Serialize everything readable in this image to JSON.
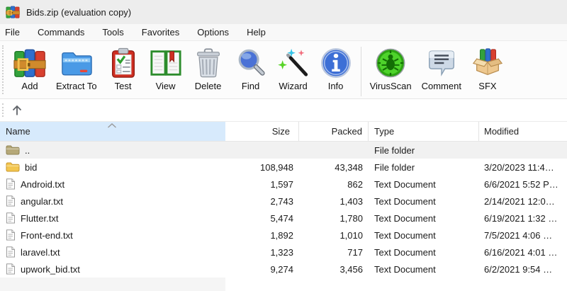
{
  "window": {
    "title": "Bids.zip (evaluation copy)",
    "app_icon": "winrar-archive-icon"
  },
  "menu_bar": {
    "items": [
      "File",
      "Commands",
      "Tools",
      "Favorites",
      "Options",
      "Help"
    ]
  },
  "toolbar": {
    "buttons": [
      {
        "label": "Add",
        "icon": "add-archive-icon"
      },
      {
        "label": "Extract To",
        "icon": "extract-to-folder-icon"
      },
      {
        "label": "Test",
        "icon": "test-clipboard-icon"
      },
      {
        "label": "View",
        "icon": "view-book-icon"
      },
      {
        "label": "Delete",
        "icon": "delete-trash-icon"
      },
      {
        "label": "Find",
        "icon": "find-magnifier-icon"
      },
      {
        "label": "Wizard",
        "icon": "wizard-wand-icon"
      },
      {
        "label": "Info",
        "icon": "info-circle-icon"
      },
      {
        "label": "VirusScan",
        "icon": "virus-scan-bug-icon"
      },
      {
        "label": "Comment",
        "icon": "comment-bubble-icon"
      },
      {
        "label": "SFX",
        "icon": "sfx-box-icon"
      }
    ]
  },
  "address_bar": {
    "up_icon": "up-arrow-icon"
  },
  "file_table": {
    "sort": {
      "column": "Name",
      "direction": "ascending"
    },
    "columns": [
      {
        "label": "Name",
        "align": "left"
      },
      {
        "label": "Size",
        "align": "right"
      },
      {
        "label": "Packed",
        "align": "right"
      },
      {
        "label": "Type",
        "align": "left"
      },
      {
        "label": "Modified",
        "align": "left"
      }
    ],
    "rows": [
      {
        "name": "..",
        "icon": "folder-up-icon",
        "size": "",
        "packed": "",
        "type": "File folder",
        "modified": ""
      },
      {
        "name": "bid",
        "icon": "folder-icon",
        "size": "108,948",
        "packed": "43,348",
        "type": "File folder",
        "modified": "3/20/2023 11:4…"
      },
      {
        "name": "Android.txt",
        "icon": "text-file-icon",
        "size": "1,597",
        "packed": "862",
        "type": "Text Document",
        "modified": "6/6/2021 5:52 P…"
      },
      {
        "name": "angular.txt",
        "icon": "text-file-icon",
        "size": "2,743",
        "packed": "1,403",
        "type": "Text Document",
        "modified": "2/14/2021 12:0…"
      },
      {
        "name": "Flutter.txt",
        "icon": "text-file-icon",
        "size": "5,474",
        "packed": "1,780",
        "type": "Text Document",
        "modified": "6/19/2021 1:32 …"
      },
      {
        "name": "Front-end.txt",
        "icon": "text-file-icon",
        "size": "1,892",
        "packed": "1,010",
        "type": "Text Document",
        "modified": "7/5/2021 4:06 …"
      },
      {
        "name": "laravel.txt",
        "icon": "text-file-icon",
        "size": "1,323",
        "packed": "717",
        "type": "Text Document",
        "modified": "6/16/2021 4:01 …"
      },
      {
        "name": "upwork_bid.txt",
        "icon": "text-file-icon",
        "size": "9,274",
        "packed": "3,456",
        "type": "Text Document",
        "modified": "6/2/2021 9:54 …"
      }
    ]
  },
  "colors": {
    "title_bar_bg": "#ededed",
    "sorted_header_bg": "#d7eafc",
    "parent_row_bg": "#f1f1f1",
    "folder_icon": "#f3c64f",
    "folder_up_icon": "#b5a878",
    "accent_blue": "#2f6fce"
  }
}
